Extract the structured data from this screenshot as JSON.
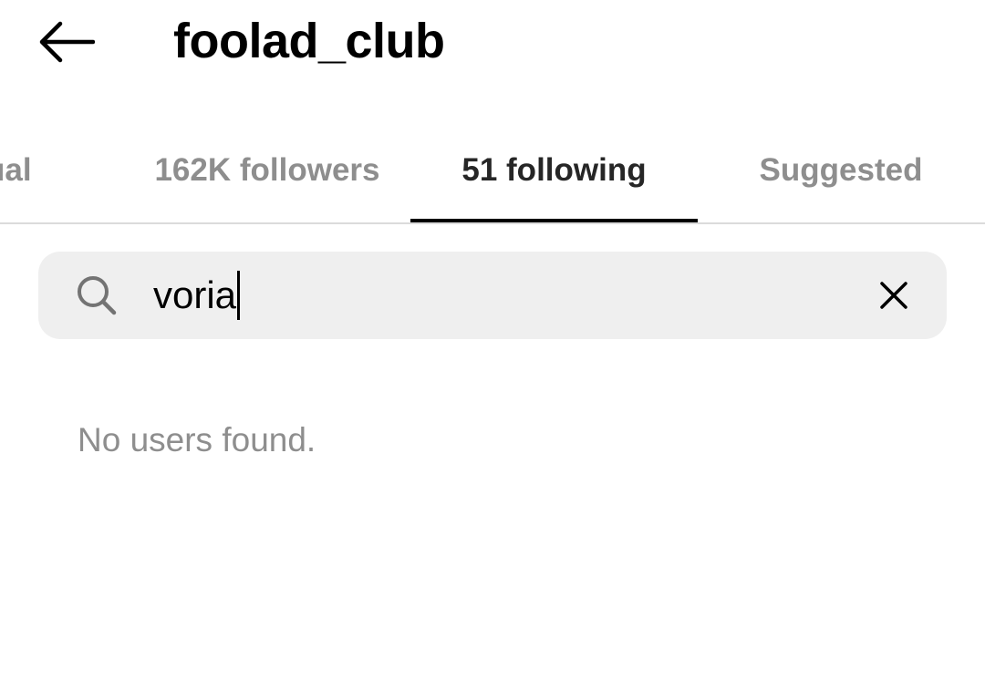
{
  "header": {
    "back_icon": "arrow-left-icon",
    "username": "foolad_club"
  },
  "tabs": [
    {
      "label": "ual",
      "active": false
    },
    {
      "label": "162K followers",
      "active": false
    },
    {
      "label": "51 following",
      "active": true
    },
    {
      "label": "Suggested",
      "active": false
    }
  ],
  "search": {
    "icon": "search-icon",
    "value": "voria",
    "clear_icon": "close-icon"
  },
  "results": {
    "empty_message": "No users found."
  },
  "colors": {
    "text_primary": "#000000",
    "text_secondary": "#8e8e8e",
    "search_bg": "#efefef",
    "divider": "#dbdbdb"
  }
}
